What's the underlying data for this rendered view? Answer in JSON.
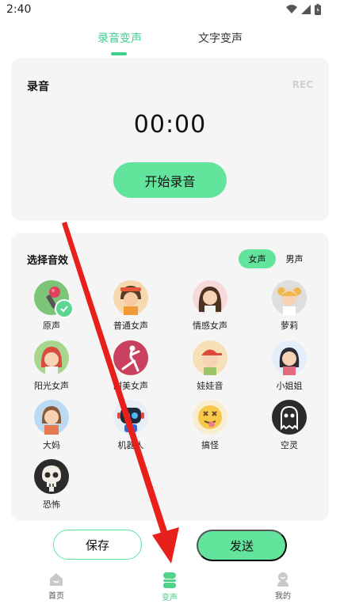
{
  "status_bar": {
    "time": "2:40"
  },
  "tabs": [
    {
      "label": "录音变声",
      "active": true
    },
    {
      "label": "文字变声",
      "active": false
    }
  ],
  "record_card": {
    "title": "录音",
    "tag": "REC",
    "timer": "00:00",
    "start_button": "开始录音"
  },
  "effects_card": {
    "title": "选择音效",
    "gender_options": [
      {
        "label": "女声",
        "selected": true
      },
      {
        "label": "男声",
        "selected": false
      }
    ],
    "effects": [
      {
        "label": "原声",
        "icon": "microphone-avatar-icon",
        "selected": true
      },
      {
        "label": "普通女声",
        "icon": "woman-avatar-icon"
      },
      {
        "label": "情感女声",
        "icon": "woman-longhair-avatar-icon"
      },
      {
        "label": "萝莉",
        "icon": "girl-avatar-icon"
      },
      {
        "label": "阳光女声",
        "icon": "redhair-girl-avatar-icon"
      },
      {
        "label": "甜美女声",
        "icon": "dancer-avatar-icon"
      },
      {
        "label": "娃娃音",
        "icon": "kid-cap-avatar-icon"
      },
      {
        "label": "小姐姐",
        "icon": "young-woman-avatar-icon"
      },
      {
        "label": "大妈",
        "icon": "aunt-avatar-icon"
      },
      {
        "label": "机器人",
        "icon": "robot-avatar-icon"
      },
      {
        "label": "搞怪",
        "icon": "silly-face-avatar-icon"
      },
      {
        "label": "空灵",
        "icon": "ghost-avatar-icon"
      },
      {
        "label": "恐怖",
        "icon": "skull-avatar-icon"
      }
    ]
  },
  "actions": {
    "save": "保存",
    "send": "发送"
  },
  "bottom_nav": [
    {
      "label": "首页",
      "icon": "home-icon",
      "active": false
    },
    {
      "label": "变声",
      "icon": "voice-change-icon",
      "active": true
    },
    {
      "label": "我的",
      "icon": "profile-icon",
      "active": false
    }
  ],
  "colors": {
    "accent": "#63e49c",
    "accent_text": "#3ed08a",
    "card_bg": "#f5f5f5",
    "annotation_arrow": "#e8201c"
  }
}
